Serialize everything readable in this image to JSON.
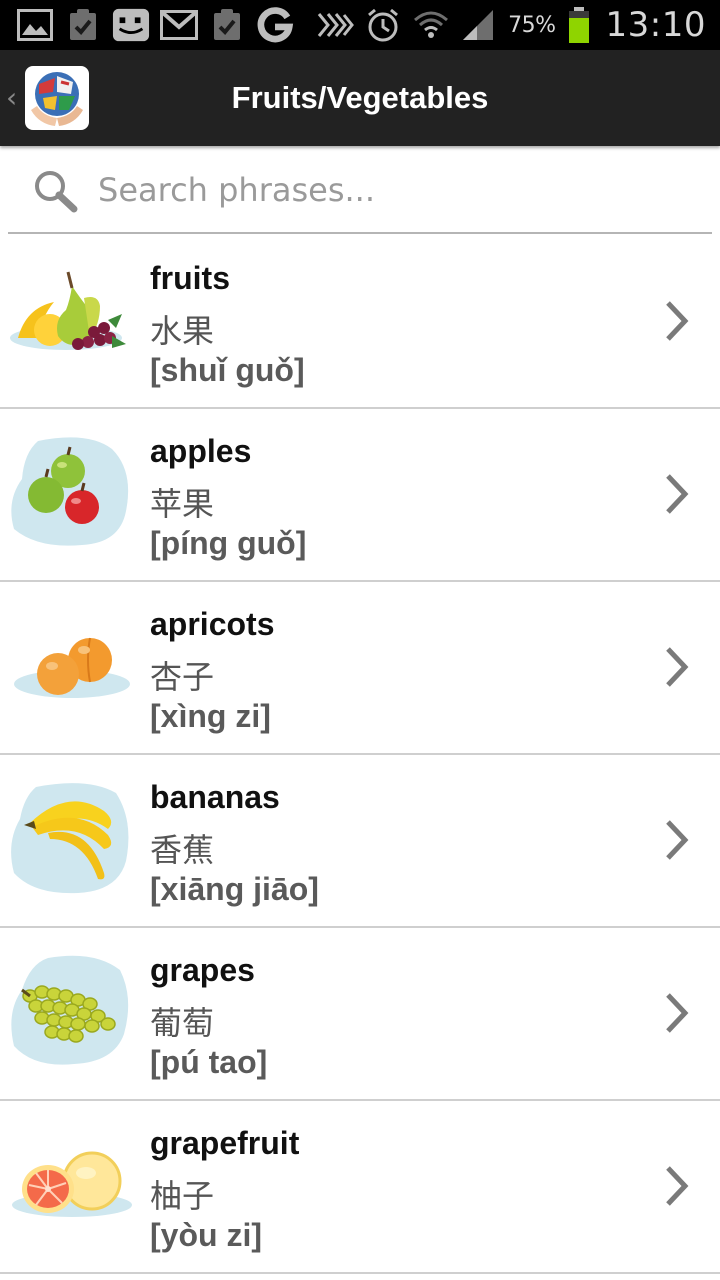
{
  "status_bar": {
    "battery_percent": "75%",
    "time": "13:10",
    "left_icons": [
      "gallery-icon",
      "task-check-icon",
      "messenger-icon",
      "gmail-icon",
      "task-check-icon",
      "google-icon"
    ],
    "right_icons": [
      "nfc-icon",
      "alarm-icon",
      "wifi-icon",
      "signal-icon",
      "battery-icon"
    ]
  },
  "action_bar": {
    "title": "Fruits/Vegetables",
    "app_icon": "globe-hands-icon"
  },
  "search": {
    "placeholder": "Search phrases..."
  },
  "items": [
    {
      "english": "fruits",
      "chinese": "水果",
      "pinyin": "[shuǐ guǒ]",
      "image": "fruits-illustration"
    },
    {
      "english": "apples",
      "chinese": "苹果",
      "pinyin": "[píng guǒ]",
      "image": "apples-illustration"
    },
    {
      "english": "apricots",
      "chinese": "杏子",
      "pinyin": "[xìng zi]",
      "image": "apricots-illustration"
    },
    {
      "english": "bananas",
      "chinese": "香蕉",
      "pinyin": "[xiāng jiāo]",
      "image": "bananas-illustration"
    },
    {
      "english": "grapes",
      "chinese": "葡萄",
      "pinyin": "[pú tao]",
      "image": "grapes-illustration"
    },
    {
      "english": "grapefruit",
      "chinese": "柚子",
      "pinyin": "[yòu zi]",
      "image": "grapefruit-illustration"
    }
  ],
  "colors": {
    "action_bar": "#222222",
    "status_bar": "#000000",
    "battery_fill": "#8fd400",
    "thumb_backdrop": "#cfe7ef"
  }
}
